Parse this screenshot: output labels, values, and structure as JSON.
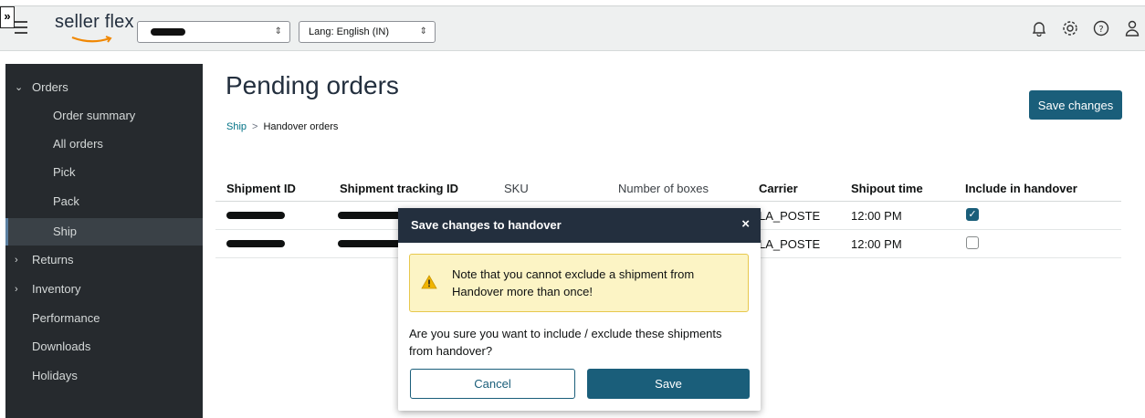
{
  "header": {
    "expand_glyph": "»",
    "logo_text": "seller flex",
    "store_select_value": "",
    "lang_select_value": "Lang: English (IN)",
    "icons": [
      "bell-icon",
      "gear-icon",
      "help-icon",
      "user-icon"
    ]
  },
  "sidebar": {
    "orders_label": "Orders",
    "sub_items": [
      "Order summary",
      "All orders",
      "Pick",
      "Pack",
      "Ship"
    ],
    "active_item": "Ship",
    "returns_label": "Returns",
    "inventory_label": "Inventory",
    "performance_label": "Performance",
    "downloads_label": "Downloads",
    "holidays_label": "Holidays"
  },
  "page": {
    "title": "Pending orders",
    "breadcrumb": {
      "link": "Ship",
      "separator": ">",
      "current": "Handover orders"
    },
    "save_changes_label": "Save changes"
  },
  "table": {
    "headers": {
      "shipment_id": "Shipment ID",
      "tracking_id": "Shipment tracking ID",
      "sku": "SKU",
      "boxes": "Number of boxes",
      "carrier": "Carrier",
      "shipout": "Shipout time",
      "include": "Include in handover"
    },
    "rows": [
      {
        "carrier": "LA_POSTE",
        "shipout": "12:00 PM",
        "included": true
      },
      {
        "carrier": "LA_POSTE",
        "shipout": "12:00 PM",
        "included": false
      }
    ]
  },
  "modal": {
    "title": "Save changes to handover",
    "close_glyph": "×",
    "alert_text": "Note that you cannot exclude a shipment from Handover more than once!",
    "body_text": "Are you sure you want to include / exclude these shipments from handover?",
    "cancel_label": "Cancel",
    "save_label": "Save"
  },
  "colors": {
    "primary": "#1a5e7a",
    "sidebar_bg": "#262a2e",
    "modal_header": "#232f3e",
    "alert_bg": "#fcf4c5"
  }
}
